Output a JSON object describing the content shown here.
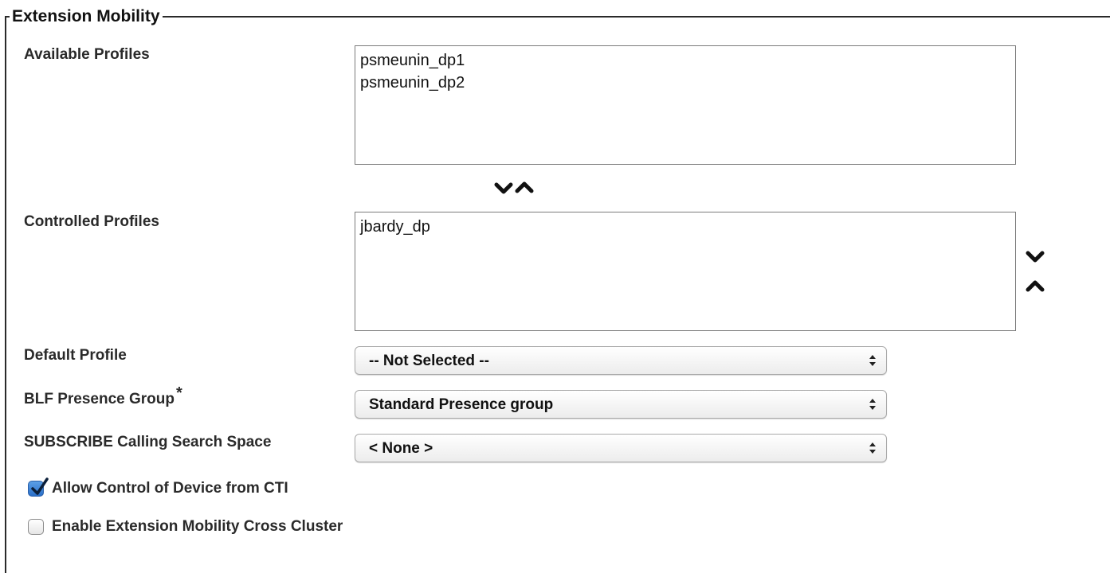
{
  "section": {
    "title": "Extension Mobility"
  },
  "available_profiles": {
    "label": "Available Profiles",
    "items": [
      "psmeunin_dp1",
      "psmeunin_dp2"
    ]
  },
  "controlled_profiles": {
    "label": "Controlled Profiles",
    "items": [
      "jbardy_dp"
    ]
  },
  "default_profile": {
    "label": "Default Profile",
    "value": "-- Not Selected --"
  },
  "blf_presence_group": {
    "label": "BLF Presence Group",
    "required_marker": "*",
    "value": "Standard Presence group"
  },
  "subscribe_css": {
    "label": "SUBSCRIBE Calling Search Space",
    "value": "< None >"
  },
  "allow_cti": {
    "label": "Allow Control of Device from CTI",
    "checked": true
  },
  "cross_cluster": {
    "label": "Enable Extension Mobility Cross Cluster",
    "checked": false
  },
  "colors": {
    "checkbox_checked": "#2a6fc9",
    "border": "#7a7a7a"
  },
  "icons": {
    "move_down": "chevron-down-icon",
    "move_up": "chevron-up-icon",
    "select_caret": "updown-caret-icon",
    "check": "checkmark-icon"
  }
}
